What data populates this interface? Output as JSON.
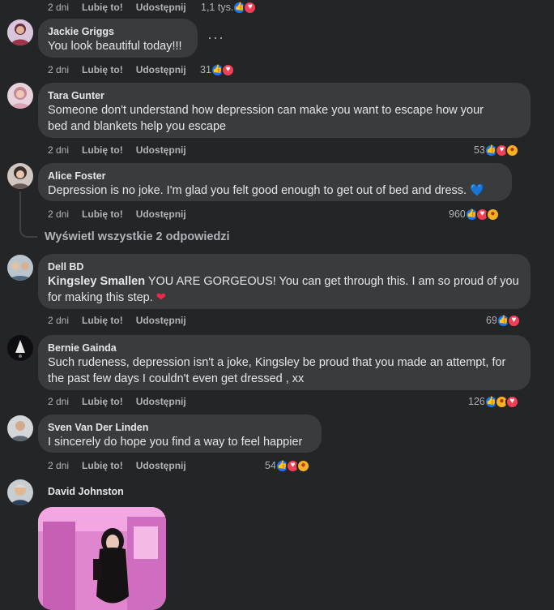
{
  "top_bar": {
    "time": "2 dni",
    "like": "Lubię to!",
    "share": "Udostępnij",
    "reaction_count": "1,1 tys."
  },
  "comments": [
    {
      "author": "Jackie Griggs",
      "text": "You look beautiful today!!!",
      "time": "2 dni",
      "like": "Lubię to!",
      "share": "Udostępnij",
      "reaction_count": "31",
      "more": "···"
    },
    {
      "author": "Tara Gunter",
      "text_line1": "Someone don't understand how depression can make you want to escape how your",
      "text_line2": "bed and blankets help you escape",
      "time": "2 dni",
      "like": "Lubię to!",
      "share": "Udostępnij",
      "reaction_count": "53"
    },
    {
      "author": "Alice Foster",
      "text": "Depression is no joke. I'm glad you felt good enough to get out of bed and dress.",
      "emoji": "💙",
      "time": "2 dni",
      "like": "Lubię to!",
      "share": "Udostępnij",
      "reaction_count": "960"
    },
    {
      "author": "Dell BD",
      "mention": "Kingsley Smallen",
      "text_line1": " YOU ARE GORGEOUS! You can get through this. I am so proud of you",
      "text_line2": "for making this step.",
      "emoji": "❤",
      "time": "2 dni",
      "like": "Lubię to!",
      "share": "Udostępnij",
      "reaction_count": "69"
    },
    {
      "author": "Bernie Gainda",
      "text_line1": "Such rudeness, depression isn't a joke, Kingsley be proud that you made an attempt, for",
      "text_line2": "the past few days I couldn't even get dressed , xx",
      "time": "2 dni",
      "like": "Lubię to!",
      "share": "Udostępnij",
      "reaction_count": "126"
    },
    {
      "author": "Sven Van Der Linden",
      "text": "I sincerely do hope you find a way to feel happier",
      "time": "2 dni",
      "like": "Lubię to!",
      "share": "Udostępnij",
      "reaction_count": "54"
    },
    {
      "author": "David Johnston"
    }
  ],
  "view_replies": "Wyświetl wszystkie 2 odpowiedzi",
  "icons": {
    "like": "thumbs-up-icon",
    "love": "heart-icon",
    "care": "care-icon",
    "more": "more-options-icon"
  },
  "colors": {
    "background": "#242526",
    "bubble": "#3a3b3c",
    "like": "#1877f2",
    "love": "#f33e58",
    "care": "#f7b125"
  }
}
